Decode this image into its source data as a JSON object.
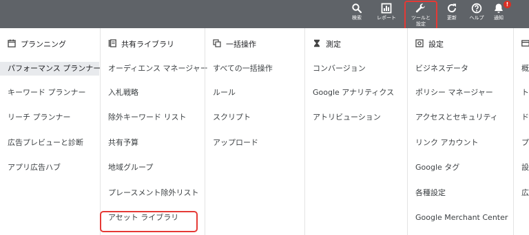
{
  "toolbar": {
    "items": [
      {
        "label": "検索",
        "icon": "search-icon"
      },
      {
        "label": "レポート",
        "icon": "reports-icon"
      },
      {
        "label": "ツールと設定",
        "icon": "wrench-icon"
      },
      {
        "label": "更新",
        "icon": "refresh-icon"
      },
      {
        "label": "ヘルプ",
        "icon": "help-icon"
      },
      {
        "label": "通知",
        "icon": "bell-icon"
      }
    ],
    "notification_badge": "!",
    "highlight_color": "#e53935"
  },
  "menu": {
    "planning": {
      "header": "プランニング",
      "icon": "calendar-icon",
      "items": [
        "パフォーマンス プランナー",
        "キーワード プランナー",
        "リーチ プランナー",
        "広告プレビューと診断",
        "アプリ広告ハブ"
      ]
    },
    "shared_library": {
      "header": "共有ライブラリ",
      "icon": "library-icon",
      "items": [
        "オーディエンス マネージャー",
        "入札戦略",
        "除外キーワード リスト",
        "共有予算",
        "地域グループ",
        "プレースメント除外リスト",
        "アセット ライブラリ"
      ]
    },
    "bulk_actions": {
      "header": "一括操作",
      "icon": "bulk-icon",
      "items": [
        "すべての一括操作",
        "ルール",
        "スクリプト",
        "アップロード"
      ]
    },
    "measurement": {
      "header": "測定",
      "icon": "hourglass-icon",
      "items": [
        "コンバージョン",
        "Google アナリティクス",
        "アトリビューション"
      ]
    },
    "setup": {
      "header": "設定",
      "icon": "settings-icon",
      "items": [
        "ビジネスデータ",
        "ポリシー マネージャー",
        "アクセスとセキュリティ",
        "リンク アカウント",
        "Google タグ",
        "各種設定",
        "Google Merchant Center"
      ]
    },
    "billing": {
      "header": "",
      "icon": "billing-icon",
      "items": [
        "概",
        "ト",
        "ド",
        "プ",
        "設",
        "広"
      ]
    }
  }
}
